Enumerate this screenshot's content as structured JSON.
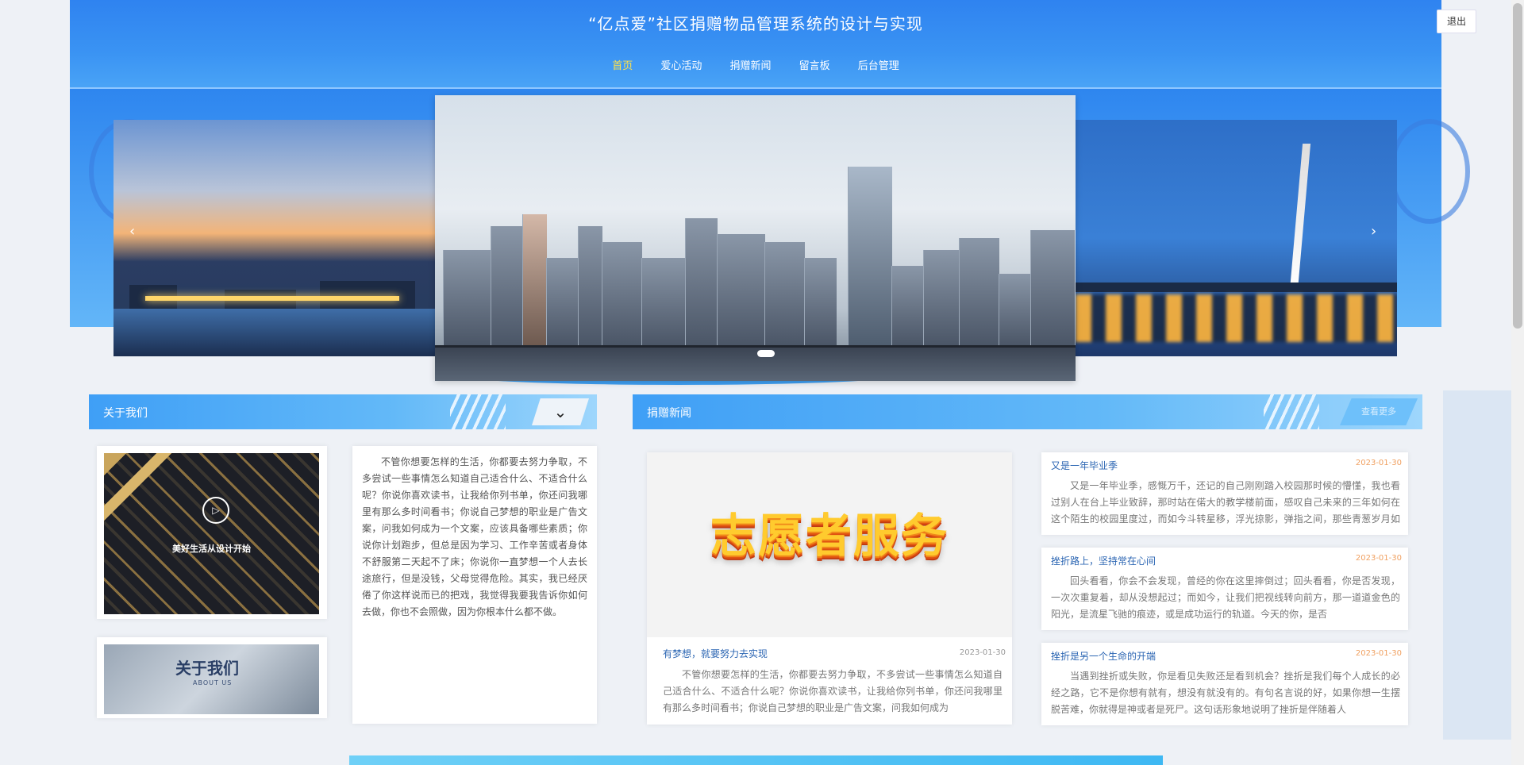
{
  "header": {
    "title": "“亿点爱”社区捐赠物品管理系统的设计与实现",
    "logout_label": "退出"
  },
  "nav": {
    "items": [
      "首页",
      "爱心活动",
      "捐赠新闻",
      "留言板",
      "后台管理"
    ],
    "active_index": 0
  },
  "carousel": {
    "prev_icon": "chevron-left-icon",
    "next_icon": "chevron-right-icon",
    "prev_glyph": "‹",
    "next_glyph": "›",
    "slides": [
      "city-night-waterfront",
      "city-skyline",
      "bridge-night"
    ],
    "active_index": 1
  },
  "about": {
    "header": "关于我们",
    "toggle_glyph": "⌄",
    "video_caption": "美好生活从设计开始",
    "play_glyph": "▷",
    "banner_title": "关于我们",
    "banner_subtitle": "ABOUT US",
    "text": "不管你想要怎样的生活，你都要去努力争取，不多尝试一些事情怎么知道自己适合什么、不适合什么呢？你说你喜欢读书，让我给你列书单，你还问我哪里有那么多时间看书；你说自己梦想的职业是广告文案，问我如何成为一个文案，应该具备哪些素质；你说你计划跑步，但总是因为学习、工作辛苦或者身体不舒服第二天起不了床；你说你一直梦想一个人去长途旅行，但是没钱，父母觉得危险。其实，我已经厌倦了你这样说而已的把戏，我觉得我要我告诉你如何去做，你也不会照做，因为你根本什么都不做。"
  },
  "news": {
    "header": "捐赠新闻",
    "more_label": "查看更多",
    "featured": {
      "image_text": "志愿者服务",
      "title": "有梦想，就要努力去实现",
      "date": "2023-01-30",
      "text": "不管你想要怎样的生活，你都要去努力争取，不多尝试一些事情怎么知道自己适合什么、不适合什么呢？你说你喜欢读书，让我给你列书单，你还问我哪里有那么多时间看书；你说自己梦想的职业是广告文案，问我如何成为"
    },
    "items": [
      {
        "title": "又是一年毕业季",
        "date": "2023-01-30",
        "text": "又是一年毕业季，感慨万千，还记的自己刚刚踏入校园那时候的懵懂，我也看过别人在台上毕业致辞，那时站在偌大的教学楼前面，感叹自己未来的三年如何在这个陌生的校园里度过，而如今斗转星移，浮光掠影，弹指之间，那些青葱岁月如同白驹"
      },
      {
        "title": "挫折路上，坚持常在心间",
        "date": "2023-01-30",
        "text": "回头看看，你会不会发现，曾经的你在这里摔倒过；回头看看，你是否发现，一次次重复着，却从没想起过；而如今，让我们把视线转向前方，那一道道金色的阳光，是流星飞驰的痕迹，或是成功运行的轨道。今天的你，是否"
      },
      {
        "title": "挫折是另一个生命的开端",
        "date": "2023-01-30",
        "text": "当遇到挫折或失败，你是看见失败还是看到机会？挫折是我们每个人成长的必经之路，它不是你想有就有，想没有就没有的。有句名言说的好，如果你想一生摆脱苦难，你就得是神或者是死尸。这句话形象地说明了挫折是伴随着人"
      }
    ]
  }
}
